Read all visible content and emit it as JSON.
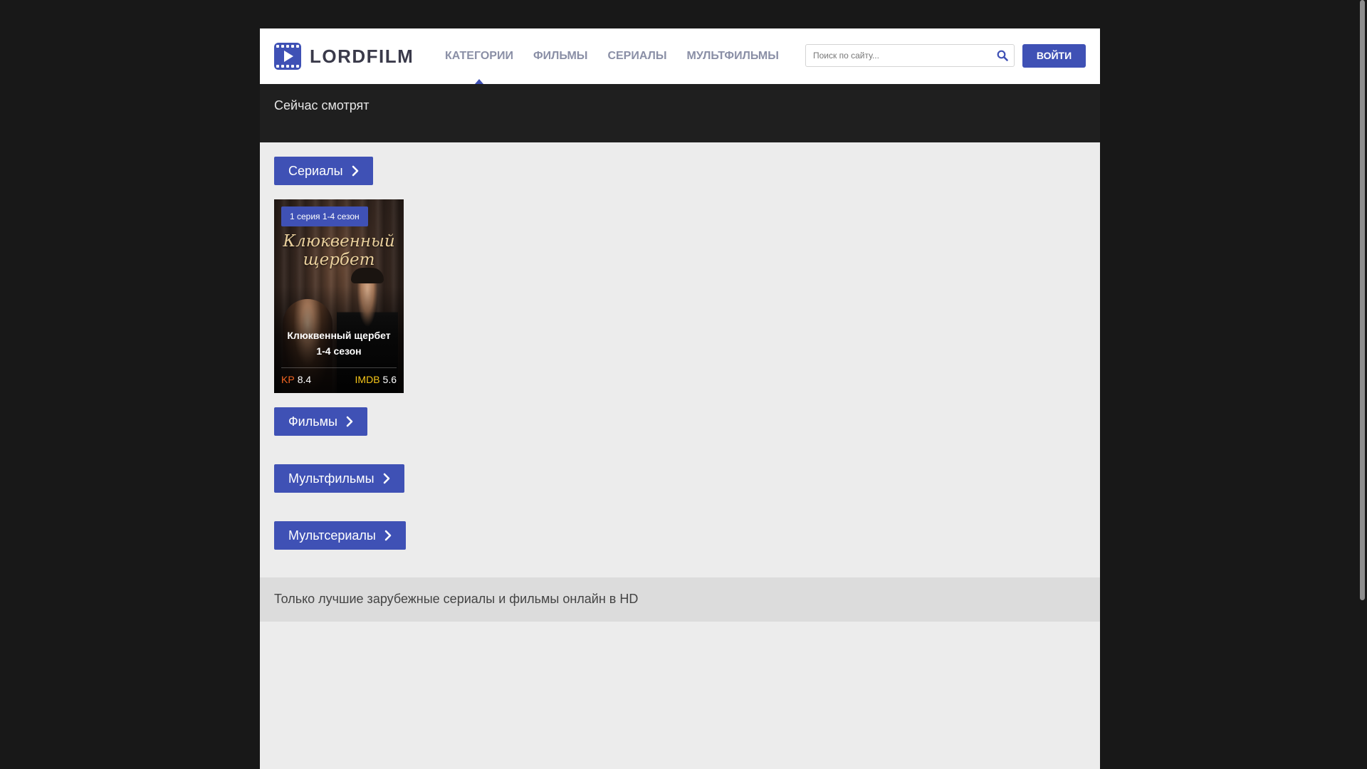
{
  "header": {
    "logo_text": "LORDFILM",
    "nav": [
      {
        "label": "КАТЕГОРИИ",
        "active": true
      },
      {
        "label": "ФИЛЬМЫ",
        "active": false
      },
      {
        "label": "СЕРИАЛЫ",
        "active": false
      },
      {
        "label": "МУЛЬТФИЛЬМЫ",
        "active": false
      }
    ],
    "search_placeholder": "Поиск по сайту...",
    "login_label": "ВОЙТИ"
  },
  "now_watching": {
    "title": "Сейчас смотрят"
  },
  "sections": {
    "serials_label": "Сериалы",
    "films_label": "Фильмы",
    "cartoons_label": "Мультфильмы",
    "cartoon_series_label": "Мультсериалы"
  },
  "card": {
    "badge": "1 серия 1-4 сезон",
    "poster_title_line1": "Клюквенный",
    "poster_title_line2": "щербет",
    "title_line1": "Клюквенный щербет",
    "title_line2": "1-4 сезон",
    "kp_label": "KP",
    "kp_value": "8.4",
    "imdb_label": "IMDB",
    "imdb_value": "5.6"
  },
  "footer": {
    "tagline": "Только лучшие зарубежные сериалы и фильмы онлайн в HD"
  },
  "colors": {
    "accent": "#3f51b5",
    "background": "#181818",
    "content_bg": "#ececec",
    "kp": "#f26522",
    "imdb": "#f5c518"
  }
}
